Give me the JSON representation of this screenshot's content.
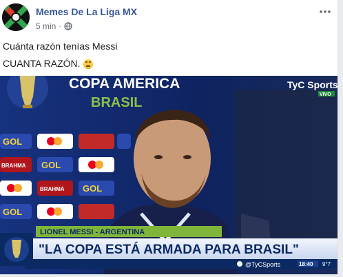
{
  "post": {
    "page_name": "Memes De La Liga MX",
    "time": "5 min",
    "separator": "·",
    "privacy_icon": "globe-icon",
    "more_icon": "more-options-icon",
    "text_line1": "Cuánta razón tenías Messi",
    "text_line2": "CUANTA RAZÓN.",
    "emoji": "rolling-eyes-emoji"
  },
  "video": {
    "tournament_title": "COPA AMERICA",
    "host_text": "BRASIL",
    "broadcaster": "TyC Sports",
    "live_label": "VIVO",
    "sponsors": [
      "GOL",
      "BRAHMA",
      "GOL",
      "BRAHMA",
      "GOL",
      "GOL"
    ],
    "speaker_name": "LIONEL MESSI - ARGENTINA",
    "quote": "\"LA COPA ESTÁ ARMADA PARA BRASIL\"",
    "handle": "@TyCSports",
    "clock": "18:40",
    "clock_suffix": "9°7"
  },
  "colors": {
    "link": "#385898",
    "tyc_green": "#1f8a3a",
    "lower_third_green": "#7fb63a",
    "lower_third_blue": "#0b2a63"
  }
}
